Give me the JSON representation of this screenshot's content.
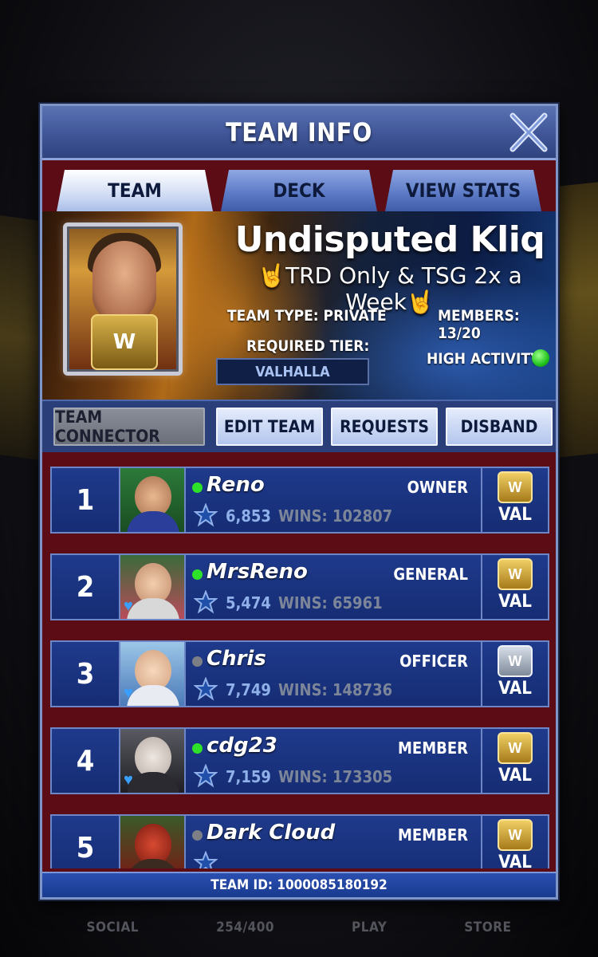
{
  "dialog": {
    "title": "TEAM INFO",
    "close_icon": "close-icon"
  },
  "tabs": [
    {
      "label": "TEAM",
      "active": true
    },
    {
      "label": "DECK",
      "active": false
    },
    {
      "label": "VIEW STATS",
      "active": false
    }
  ],
  "team": {
    "name": "Undisputed Kliq",
    "description": "TRD Only & TSG 2x a Week",
    "type_label": "TEAM TYPE: PRIVATE",
    "members_label": "MEMBERS: 13/20",
    "required_tier_label": "REQUIRED TIER:",
    "required_tier_value": "VALHALLA",
    "activity_label": "HIGH ACTIVITY",
    "activity_color": "#21c41c"
  },
  "actions": [
    {
      "label": "TEAM CONNECTOR",
      "style": "gray"
    },
    {
      "label": "EDIT TEAM",
      "style": "light"
    },
    {
      "label": "REQUESTS",
      "style": "light"
    },
    {
      "label": "DISBAND",
      "style": "light"
    }
  ],
  "members": [
    {
      "rank": "1",
      "name": "Reno",
      "role": "OWNER",
      "rating": "6,853",
      "wins": "WINS: 102807",
      "online": true,
      "tier": "VAL",
      "favorite": false
    },
    {
      "rank": "2",
      "name": "MrsReno",
      "role": "GENERAL",
      "rating": "5,474",
      "wins": "WINS: 65961",
      "online": true,
      "tier": "VAL",
      "favorite": true
    },
    {
      "rank": "3",
      "name": "Chris",
      "role": "OFFICER",
      "rating": "7,749",
      "wins": "WINS: 148736",
      "online": false,
      "tier": "VAL",
      "favorite": true
    },
    {
      "rank": "4",
      "name": "cdg23",
      "role": "MEMBER",
      "rating": "7,159",
      "wins": "WINS: 173305",
      "online": true,
      "tier": "VAL",
      "favorite": true
    },
    {
      "rank": "5",
      "name": "Dark Cloud",
      "role": "MEMBER",
      "rating": "",
      "wins": "",
      "online": false,
      "tier": "VAL",
      "favorite": false
    }
  ],
  "footer": {
    "team_id": "TEAM ID: 1000085180192"
  },
  "bottom_nav": [
    "SOCIAL",
    "254/400",
    "PLAY",
    "STORE"
  ],
  "colors": {
    "accent_blue": "#2f447f",
    "row_blue": "#1f3a8c",
    "online": "#2ee22a",
    "offline": "#7d7f86",
    "dialog_bg": "#5b0c14"
  }
}
